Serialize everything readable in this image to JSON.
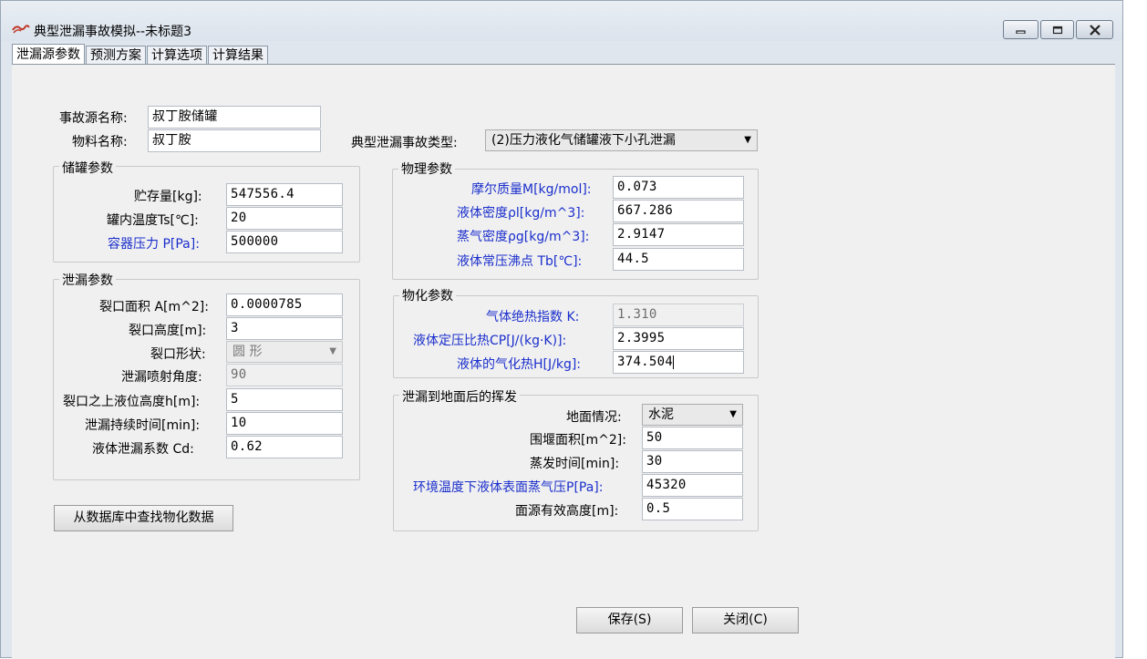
{
  "window": {
    "title": "典型泄漏事故模拟--未标题3",
    "icon": "app-logo-icon",
    "controls": [
      "minimize-icon",
      "maximize-icon",
      "close-icon"
    ]
  },
  "tabs": [
    {
      "label": "泄漏源参数",
      "active": true
    },
    {
      "label": "预测方案",
      "active": false
    },
    {
      "label": "计算选项",
      "active": false
    },
    {
      "label": "计算结果",
      "active": false
    }
  ],
  "header": {
    "source_name_label": "事故源名称:",
    "source_name_value": "叔丁胺储罐",
    "material_label": "物料名称:",
    "material_value": "叔丁胺",
    "accident_type_label": "典型泄漏事故类型:",
    "accident_type_value": "(2)压力液化气储罐液下小孔泄漏"
  },
  "tank": {
    "title": "储罐参数",
    "storage_label": "贮存量[kg]:",
    "storage_value": "547556.4",
    "temp_label": "罐内温度Ts[℃]:",
    "temp_value": "20",
    "pressure_label": "容器压力 P[Pa]:",
    "pressure_value": "500000"
  },
  "leak": {
    "title": "泄漏参数",
    "area_label": "裂口面积 A[m^2]:",
    "area_value": "0.0000785",
    "height_label": "裂口高度[m]:",
    "height_value": "3",
    "shape_label": "裂口形状:",
    "shape_value": "圆  形",
    "angle_label": "泄漏喷射角度:",
    "angle_value": "90",
    "liquid_level_label": "裂口之上液位高度h[m]:",
    "liquid_level_value": "5",
    "duration_label": "泄漏持续时间[min]:",
    "duration_value": "10",
    "coef_label": "液体泄漏系数  Cd:",
    "coef_value": "0.62"
  },
  "physical": {
    "title": "物理参数",
    "molar_label": "摩尔质量M[kg/mol]:",
    "molar_value": "0.073",
    "liquid_density_label": "液体密度ρl[kg/m^3]:",
    "liquid_density_value": "667.286",
    "vapor_density_label": "蒸气密度ρg[kg/m^3]:",
    "vapor_density_value": "2.9147",
    "boiling_label": "液体常压沸点 Tb[℃]:",
    "boiling_value": "44.5"
  },
  "chemical": {
    "title": "物化参数",
    "k_label": "气体绝热指数  K:",
    "k_value": "1.310",
    "cp_label": "液体定压比热CP[J/(kg·K)]:",
    "cp_value": "2.3995",
    "heat_label": "液体的气化热H[J/kg]:",
    "heat_value": "374.504"
  },
  "evaporation": {
    "title": "泄漏到地面后的挥发",
    "ground_label": "地面情况:",
    "ground_value": "水泥",
    "dike_label": "围堰面积[m^2]:",
    "dike_value": "50",
    "evap_time_label": "蒸发时间[min]:",
    "evap_time_value": "30",
    "vapor_pressure_label": "环境温度下液体表面蒸气压P[Pa]:",
    "vapor_pressure_value": "45320",
    "source_height_label": "面源有效高度[m]:",
    "source_height_value": "0.5"
  },
  "buttons": {
    "lookup": "从数据库中查找物化数据",
    "save": "保存(S)",
    "close": "关闭(C)"
  },
  "colors": {
    "blue_label": "#1a2ecc",
    "window_bg": "#f0f0f0"
  }
}
